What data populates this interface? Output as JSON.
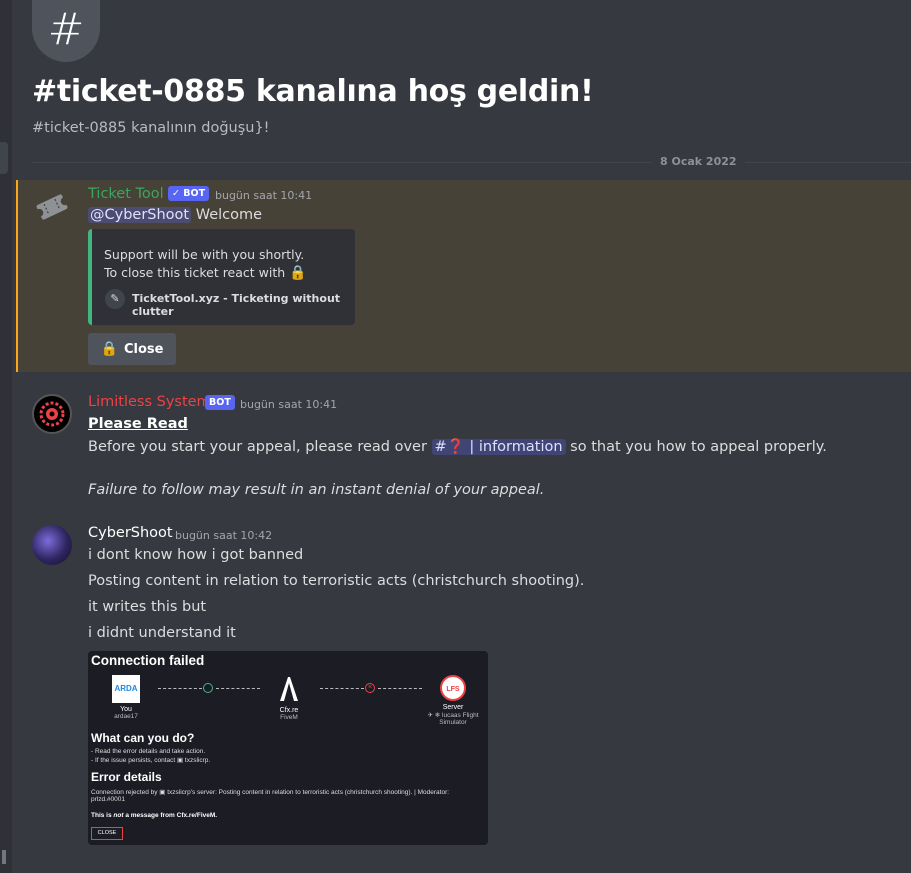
{
  "channel": {
    "icon": "hash-icon",
    "welcome_title": "#ticket-0885 kanalına hoş geldin!",
    "welcome_sub": "#ticket-0885 kanalının doğuşu}!",
    "date_divider": "8 Ocak 2022"
  },
  "messages": [
    {
      "author": "Ticket Tool",
      "author_color": "#3ba55d",
      "bot": "✓ BOT",
      "timestamp": "bugün saat 10:41",
      "text_mention": "@CyberShoot",
      "text_rest": " Welcome",
      "embed": {
        "line1": "Support will be with you shortly.",
        "line2": "To close this ticket react with",
        "footer": "TicketTool.xyz - Ticketing without clutter"
      },
      "button_label": "Close"
    },
    {
      "author": "Limitless System",
      "author_color": "#ed4245",
      "bot": "BOT",
      "timestamp": "bugün saat 10:41",
      "heading": "Please Read",
      "body_before": "Before you start your appeal, please read over ",
      "channel_mention": "#❓ | information",
      "body_after": " so that you how to appeal properly.",
      "italic": "Failure to follow may result in an instant denial of your appeal."
    },
    {
      "author": "CyberShoot",
      "author_color": "#ffffff",
      "timestamp": "bugün saat 10:42",
      "lines": [
        "i dont know how i got banned",
        "Posting content in relation to terroristic acts (christchurch shooting).",
        "it writes this but",
        "i didnt understand it"
      ]
    }
  ],
  "attachment": {
    "title": "Connection failed",
    "you_label": "You",
    "you_sub": "ardae17",
    "logo_text": "ARDA",
    "mid_label": "Cfx.re",
    "mid_sub": "FiveM",
    "server_label": "Server",
    "server_sub1": "✈ ❄ lucaas Flight",
    "server_sub2": "Simulator",
    "server_logo": "LFS",
    "what_heading": "What can you do?",
    "what_1": "- Read the error details and take action.",
    "what_2": "- If the issue persists, contact ▣ txzslicrp.",
    "error_heading": "Error details",
    "error_1": "Connection rejected by ▣ txzslicrp's server: Posting content in relation to terroristic acts (christchurch shooting). | Moderator:",
    "error_2": "prlzd.#0001",
    "note_pre": "This is ",
    "note_em": "not",
    "note_post": " a message from Cfx.re/FiveM.",
    "close": "CLOSE"
  }
}
